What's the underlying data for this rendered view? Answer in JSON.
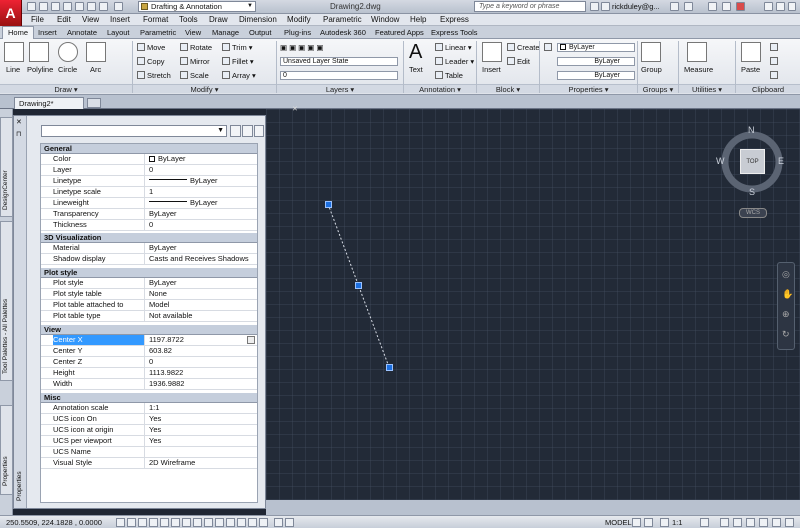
{
  "app": {
    "logo": "A",
    "title": "Drawing2.dwg",
    "workspace": "Drafting & Annotation",
    "search_placeholder": "Type a keyword or phrase",
    "user": "rickduley@g..."
  },
  "menus": [
    "File",
    "Edit",
    "View",
    "Insert",
    "Format",
    "Tools",
    "Draw",
    "Dimension",
    "Modify",
    "Parametric",
    "Window",
    "Help",
    "Express"
  ],
  "ribbon_tabs": [
    "Home",
    "Insert",
    "Annotate",
    "Layout",
    "Parametric",
    "View",
    "Manage",
    "Output",
    "Plug-ins",
    "Autodesk 360",
    "Featured Apps",
    "Express Tools"
  ],
  "draw": {
    "label": "Draw ▾",
    "tools": [
      "Line",
      "Polyline",
      "Circle",
      "Arc"
    ]
  },
  "modify": {
    "label": "Modify ▾",
    "tools": [
      "Move",
      "Copy",
      "Stretch",
      "Rotate",
      "Mirror",
      "Scale",
      "Trim ▾",
      "Fillet ▾",
      "Array ▾"
    ]
  },
  "layers": {
    "label": "Layers ▾",
    "state": "Unsaved Layer State",
    "current": "0"
  },
  "annotation": {
    "label": "Annotation ▾",
    "text": "Text",
    "linear": "Linear ▾",
    "leader": "Leader ▾",
    "table": "Table"
  },
  "block": {
    "label": "Block ▾",
    "insert": "Insert",
    "create": "Create",
    "edit": "Edit"
  },
  "properties": {
    "label": "Properties ▾",
    "bylayer": "ByLayer"
  },
  "groups": {
    "label": "Groups ▾",
    "group": "Group"
  },
  "utilities": {
    "label": "Utilities ▾",
    "measure": "Measure"
  },
  "clipboard": {
    "label": "Clipboard",
    "paste": "Paste"
  },
  "doc_tab": "Drawing2*",
  "viewcube": {
    "n": "N",
    "s": "S",
    "e": "E",
    "w": "W",
    "top": "TOP",
    "wcs": "WCS"
  },
  "left_tabs": {
    "design": "DesignCenter",
    "tool": "Tool Palettes - All Palettes",
    "props": "Properties"
  },
  "palette": {
    "strip_label": "Properties",
    "general": {
      "title": "General",
      "rows": [
        [
          "Color",
          "ByLayer"
        ],
        [
          "Layer",
          "0"
        ],
        [
          "Linetype",
          "ByLayer"
        ],
        [
          "Linetype scale",
          "1"
        ],
        [
          "Lineweight",
          "ByLayer"
        ],
        [
          "Transparency",
          "ByLayer"
        ],
        [
          "Thickness",
          "0"
        ]
      ]
    },
    "viz": {
      "title": "3D Visualization",
      "rows": [
        [
          "Material",
          "ByLayer"
        ],
        [
          "Shadow display",
          "Casts and Receives Shadows"
        ]
      ]
    },
    "plot": {
      "title": "Plot style",
      "rows": [
        [
          "Plot style",
          "ByLayer"
        ],
        [
          "Plot style table",
          "None"
        ],
        [
          "Plot table attached to",
          "Model"
        ],
        [
          "Plot table type",
          "Not available"
        ]
      ]
    },
    "view": {
      "title": "View",
      "rows": [
        [
          "Center X",
          "1197.8722"
        ],
        [
          "Center Y",
          "603.82"
        ],
        [
          "Center Z",
          "0"
        ],
        [
          "Height",
          "1113.9822"
        ],
        [
          "Width",
          "1936.9882"
        ]
      ]
    },
    "misc": {
      "title": "Misc",
      "rows": [
        [
          "Annotation scale",
          "1:1"
        ],
        [
          "UCS icon On",
          "Yes"
        ],
        [
          "UCS icon at origin",
          "Yes"
        ],
        [
          "UCS per viewport",
          "Yes"
        ],
        [
          "UCS Name",
          ""
        ],
        [
          "Visual Style",
          "2D Wireframe"
        ]
      ]
    }
  },
  "status": {
    "coords": "250.5509, 224.1828 , 0.0000",
    "model": "MODEL",
    "scale": "1:1"
  }
}
